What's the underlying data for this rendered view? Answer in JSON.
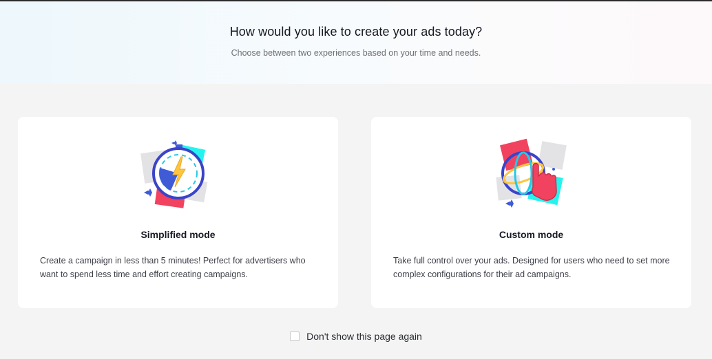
{
  "header": {
    "title": "How would you like to create your ads today?",
    "subtitle": "Choose between two experiences based on your time and needs."
  },
  "cards": [
    {
      "title": "Simplified mode",
      "description": "Create a campaign in less than 5 minutes! Perfect for advertisers who want to spend less time and effort creating campaigns.",
      "icon": "stopwatch-lightning-icon"
    },
    {
      "title": "Custom mode",
      "description": "Take full control over your ads. Designed for users who need to set more complex configurations for their ad campaigns.",
      "icon": "globe-hand-pointer-icon"
    }
  ],
  "footer": {
    "checkbox_label": "Don't show this page again",
    "checked": false
  },
  "colors": {
    "accent_blue": "#3f5bd6",
    "accent_red": "#f1425f",
    "accent_cyan": "#25f4ee",
    "accent_yellow": "#ffc53d"
  }
}
